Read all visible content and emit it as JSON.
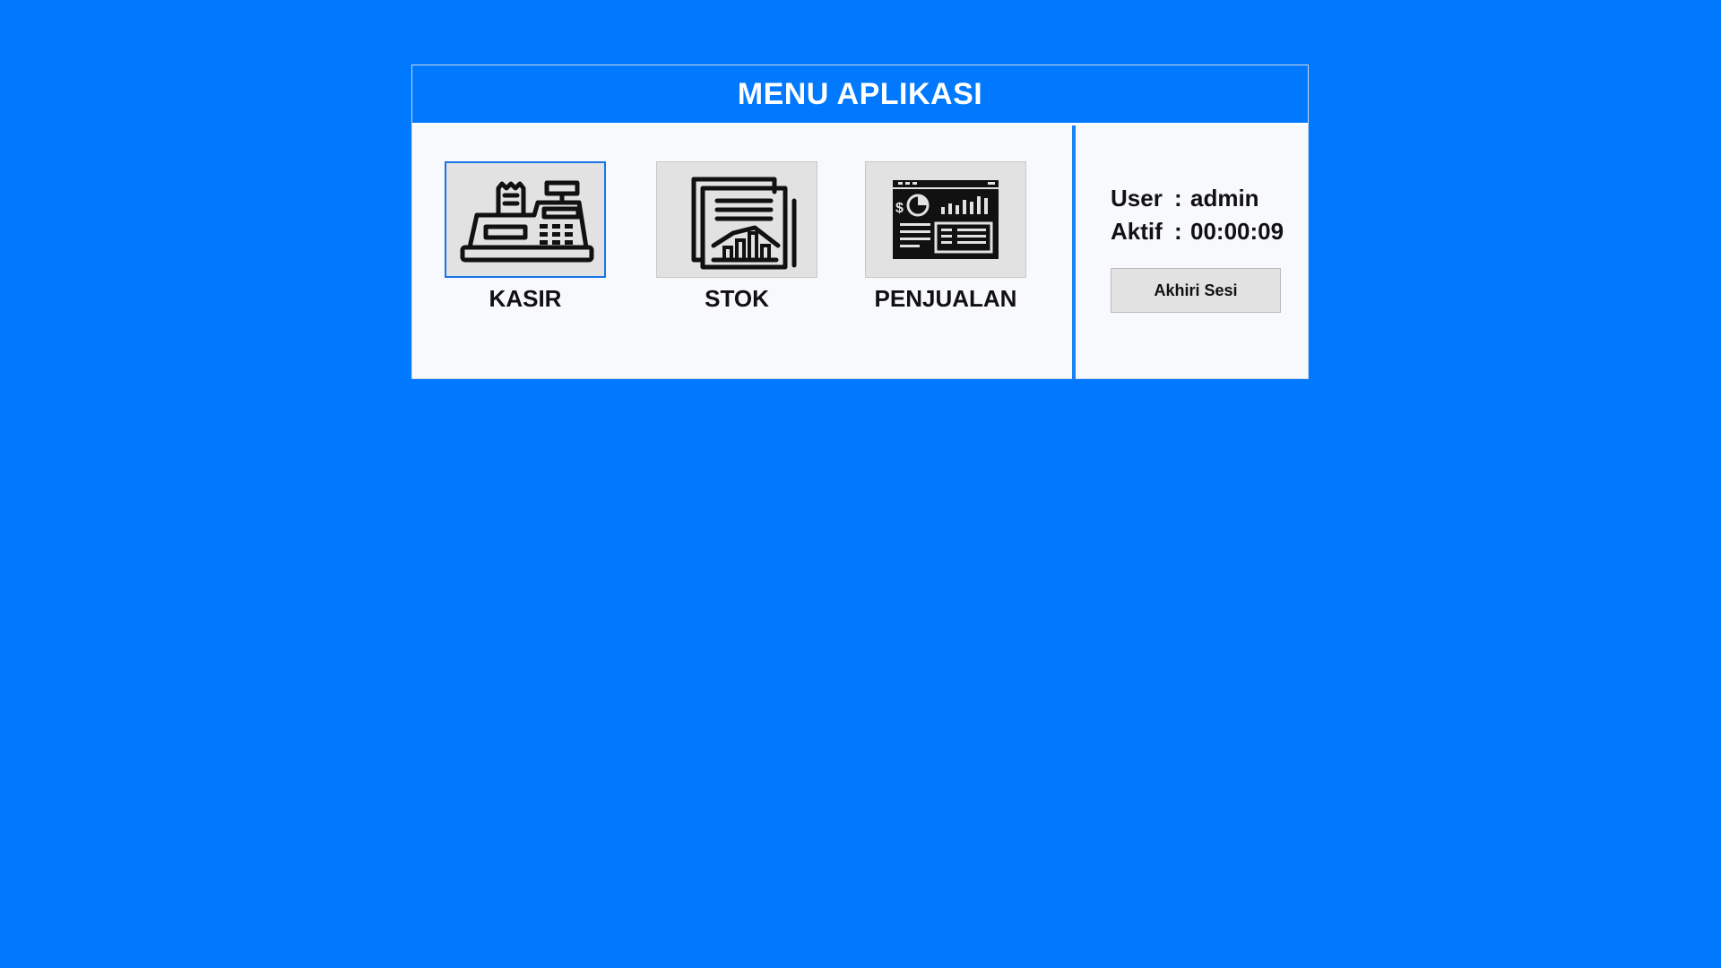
{
  "header": {
    "title": "MENU APLIKASI"
  },
  "menu": [
    {
      "label": "KASIR",
      "icon": "cash-register-icon",
      "selected": true
    },
    {
      "label": "STOK",
      "icon": "stock-report-icon",
      "selected": false
    },
    {
      "label": "PENJUALAN",
      "icon": "sales-dashboard-icon",
      "selected": false
    }
  ],
  "session": {
    "user_key": "User",
    "user_value": "admin",
    "active_key": "Aktif",
    "active_value": "00:00:09",
    "separator": ":",
    "end_button": "Akhiri Sesi"
  },
  "colors": {
    "background": "#0079ff",
    "panel": "#f8f9fd",
    "divider": "#1a82f5",
    "tile": "#e2e2e2",
    "selected_border": "#1a74e8"
  }
}
